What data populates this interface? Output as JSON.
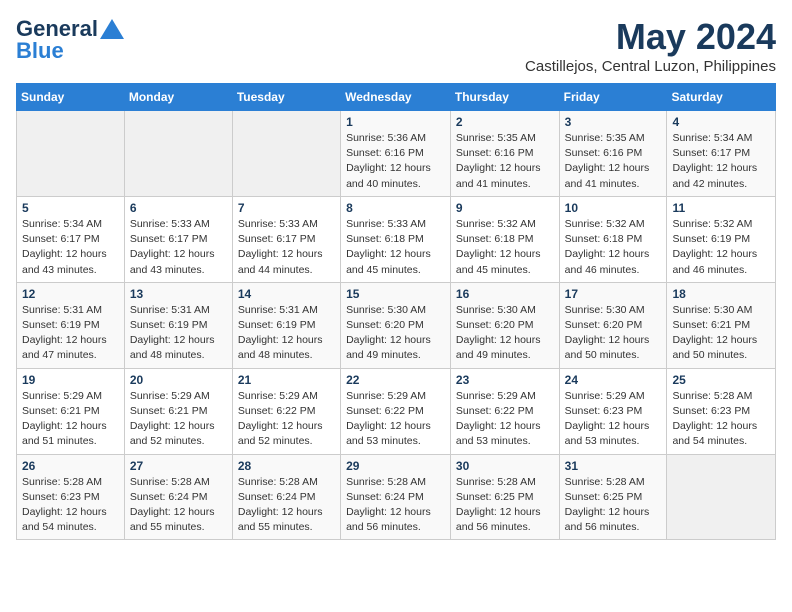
{
  "logo": {
    "general": "General",
    "blue": "Blue"
  },
  "title": "May 2024",
  "location": "Castillejos, Central Luzon, Philippines",
  "days_of_week": [
    "Sunday",
    "Monday",
    "Tuesday",
    "Wednesday",
    "Thursday",
    "Friday",
    "Saturday"
  ],
  "weeks": [
    [
      {
        "day": "",
        "sunrise": "",
        "sunset": "",
        "daylight": ""
      },
      {
        "day": "",
        "sunrise": "",
        "sunset": "",
        "daylight": ""
      },
      {
        "day": "",
        "sunrise": "",
        "sunset": "",
        "daylight": ""
      },
      {
        "day": "1",
        "sunrise": "Sunrise: 5:36 AM",
        "sunset": "Sunset: 6:16 PM",
        "daylight": "Daylight: 12 hours and 40 minutes."
      },
      {
        "day": "2",
        "sunrise": "Sunrise: 5:35 AM",
        "sunset": "Sunset: 6:16 PM",
        "daylight": "Daylight: 12 hours and 41 minutes."
      },
      {
        "day": "3",
        "sunrise": "Sunrise: 5:35 AM",
        "sunset": "Sunset: 6:16 PM",
        "daylight": "Daylight: 12 hours and 41 minutes."
      },
      {
        "day": "4",
        "sunrise": "Sunrise: 5:34 AM",
        "sunset": "Sunset: 6:17 PM",
        "daylight": "Daylight: 12 hours and 42 minutes."
      }
    ],
    [
      {
        "day": "5",
        "sunrise": "Sunrise: 5:34 AM",
        "sunset": "Sunset: 6:17 PM",
        "daylight": "Daylight: 12 hours and 43 minutes."
      },
      {
        "day": "6",
        "sunrise": "Sunrise: 5:33 AM",
        "sunset": "Sunset: 6:17 PM",
        "daylight": "Daylight: 12 hours and 43 minutes."
      },
      {
        "day": "7",
        "sunrise": "Sunrise: 5:33 AM",
        "sunset": "Sunset: 6:17 PM",
        "daylight": "Daylight: 12 hours and 44 minutes."
      },
      {
        "day": "8",
        "sunrise": "Sunrise: 5:33 AM",
        "sunset": "Sunset: 6:18 PM",
        "daylight": "Daylight: 12 hours and 45 minutes."
      },
      {
        "day": "9",
        "sunrise": "Sunrise: 5:32 AM",
        "sunset": "Sunset: 6:18 PM",
        "daylight": "Daylight: 12 hours and 45 minutes."
      },
      {
        "day": "10",
        "sunrise": "Sunrise: 5:32 AM",
        "sunset": "Sunset: 6:18 PM",
        "daylight": "Daylight: 12 hours and 46 minutes."
      },
      {
        "day": "11",
        "sunrise": "Sunrise: 5:32 AM",
        "sunset": "Sunset: 6:19 PM",
        "daylight": "Daylight: 12 hours and 46 minutes."
      }
    ],
    [
      {
        "day": "12",
        "sunrise": "Sunrise: 5:31 AM",
        "sunset": "Sunset: 6:19 PM",
        "daylight": "Daylight: 12 hours and 47 minutes."
      },
      {
        "day": "13",
        "sunrise": "Sunrise: 5:31 AM",
        "sunset": "Sunset: 6:19 PM",
        "daylight": "Daylight: 12 hours and 48 minutes."
      },
      {
        "day": "14",
        "sunrise": "Sunrise: 5:31 AM",
        "sunset": "Sunset: 6:19 PM",
        "daylight": "Daylight: 12 hours and 48 minutes."
      },
      {
        "day": "15",
        "sunrise": "Sunrise: 5:30 AM",
        "sunset": "Sunset: 6:20 PM",
        "daylight": "Daylight: 12 hours and 49 minutes."
      },
      {
        "day": "16",
        "sunrise": "Sunrise: 5:30 AM",
        "sunset": "Sunset: 6:20 PM",
        "daylight": "Daylight: 12 hours and 49 minutes."
      },
      {
        "day": "17",
        "sunrise": "Sunrise: 5:30 AM",
        "sunset": "Sunset: 6:20 PM",
        "daylight": "Daylight: 12 hours and 50 minutes."
      },
      {
        "day": "18",
        "sunrise": "Sunrise: 5:30 AM",
        "sunset": "Sunset: 6:21 PM",
        "daylight": "Daylight: 12 hours and 50 minutes."
      }
    ],
    [
      {
        "day": "19",
        "sunrise": "Sunrise: 5:29 AM",
        "sunset": "Sunset: 6:21 PM",
        "daylight": "Daylight: 12 hours and 51 minutes."
      },
      {
        "day": "20",
        "sunrise": "Sunrise: 5:29 AM",
        "sunset": "Sunset: 6:21 PM",
        "daylight": "Daylight: 12 hours and 52 minutes."
      },
      {
        "day": "21",
        "sunrise": "Sunrise: 5:29 AM",
        "sunset": "Sunset: 6:22 PM",
        "daylight": "Daylight: 12 hours and 52 minutes."
      },
      {
        "day": "22",
        "sunrise": "Sunrise: 5:29 AM",
        "sunset": "Sunset: 6:22 PM",
        "daylight": "Daylight: 12 hours and 53 minutes."
      },
      {
        "day": "23",
        "sunrise": "Sunrise: 5:29 AM",
        "sunset": "Sunset: 6:22 PM",
        "daylight": "Daylight: 12 hours and 53 minutes."
      },
      {
        "day": "24",
        "sunrise": "Sunrise: 5:29 AM",
        "sunset": "Sunset: 6:23 PM",
        "daylight": "Daylight: 12 hours and 53 minutes."
      },
      {
        "day": "25",
        "sunrise": "Sunrise: 5:28 AM",
        "sunset": "Sunset: 6:23 PM",
        "daylight": "Daylight: 12 hours and 54 minutes."
      }
    ],
    [
      {
        "day": "26",
        "sunrise": "Sunrise: 5:28 AM",
        "sunset": "Sunset: 6:23 PM",
        "daylight": "Daylight: 12 hours and 54 minutes."
      },
      {
        "day": "27",
        "sunrise": "Sunrise: 5:28 AM",
        "sunset": "Sunset: 6:24 PM",
        "daylight": "Daylight: 12 hours and 55 minutes."
      },
      {
        "day": "28",
        "sunrise": "Sunrise: 5:28 AM",
        "sunset": "Sunset: 6:24 PM",
        "daylight": "Daylight: 12 hours and 55 minutes."
      },
      {
        "day": "29",
        "sunrise": "Sunrise: 5:28 AM",
        "sunset": "Sunset: 6:24 PM",
        "daylight": "Daylight: 12 hours and 56 minutes."
      },
      {
        "day": "30",
        "sunrise": "Sunrise: 5:28 AM",
        "sunset": "Sunset: 6:25 PM",
        "daylight": "Daylight: 12 hours and 56 minutes."
      },
      {
        "day": "31",
        "sunrise": "Sunrise: 5:28 AM",
        "sunset": "Sunset: 6:25 PM",
        "daylight": "Daylight: 12 hours and 56 minutes."
      },
      {
        "day": "",
        "sunrise": "",
        "sunset": "",
        "daylight": ""
      }
    ]
  ]
}
